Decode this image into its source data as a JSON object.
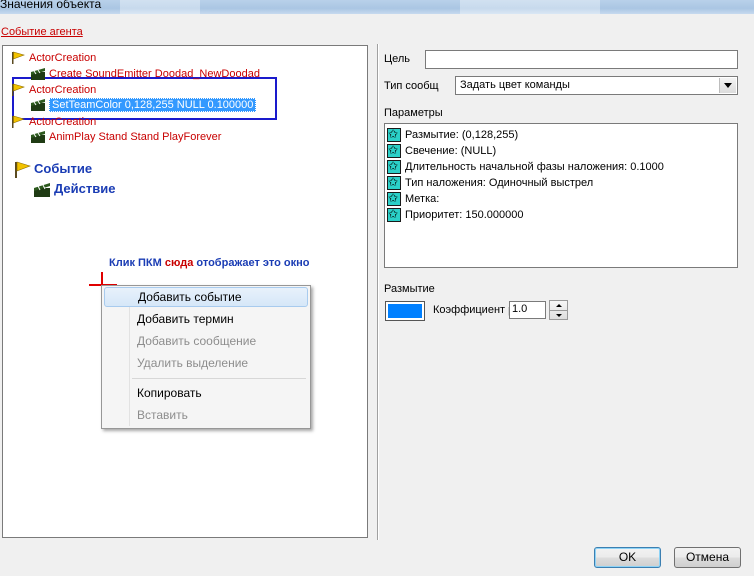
{
  "window": {
    "title": "Значения объекта"
  },
  "agent_event_link": "Событие агента",
  "tree": {
    "nodes": [
      {
        "label": "ActorCreation",
        "kind": "event"
      },
      {
        "label": "Create SoundEmitter Doodad_NewDoodad",
        "kind": "action"
      },
      {
        "label": "ActorCreation",
        "kind": "event"
      },
      {
        "label": "SetTeamColor 0,128,255 NULL 0.100000",
        "kind": "action",
        "selected": true
      },
      {
        "label": "ActorCreation",
        "kind": "event"
      },
      {
        "label": "AnimPlay Stand Stand PlayForever",
        "kind": "action"
      }
    ],
    "legend_event": "Событие",
    "legend_action": "Действие"
  },
  "annotation": {
    "part1": "Клик ПКМ ",
    "part2": "сюда",
    "part3": " отображает это окно"
  },
  "context_menu": {
    "items": [
      {
        "label": "Добавить событие",
        "enabled": true,
        "hover": true
      },
      {
        "label": "Добавить термин",
        "enabled": true
      },
      {
        "label": "Добавить сообщение",
        "enabled": false
      },
      {
        "label": "Удалить выделение",
        "enabled": false
      },
      {
        "label": "Копировать",
        "enabled": true
      },
      {
        "label": "Вставить",
        "enabled": false
      }
    ]
  },
  "right_panel": {
    "target_label": "Цель",
    "target_value": "",
    "msg_type_label": "Тип сообщ",
    "msg_type_value": "Задать цвет команды",
    "params_label": "Параметры",
    "params": [
      "Размытие: (0,128,255)",
      "Свечение: (NULL)",
      "Длительность начальной фазы наложения: 0.1000",
      "Тип наложения: Одиночный выстрел",
      "Метка:",
      "Приоритет: 150.000000"
    ],
    "blur_label": "Размытие",
    "blur_color": "#0080ff",
    "coef_label": "Коэффициент р",
    "coef_value": "1.0"
  },
  "buttons": {
    "ok": "OK",
    "cancel": "Отмена"
  },
  "icons": {
    "event": "yellow-flag-icon",
    "action": "clapperboard-icon",
    "param": "star-param-icon"
  },
  "colors": {
    "red_text": "#c80000",
    "blue_text": "#1a3cb4",
    "selection": "#3399ff",
    "highlight_frame": "#1a1acc"
  }
}
